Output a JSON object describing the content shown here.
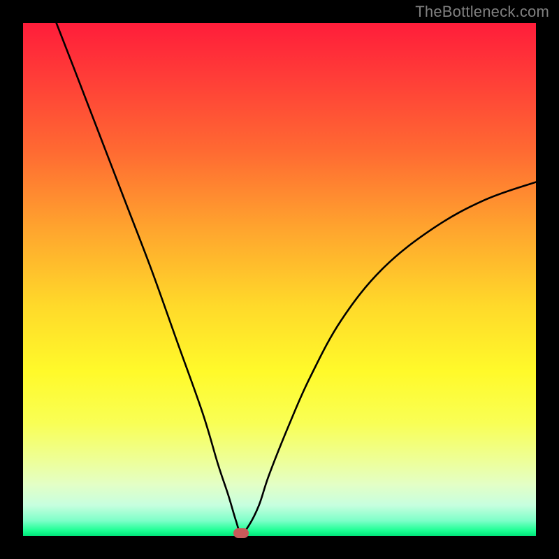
{
  "watermark": "TheBottleneck.com",
  "chart_data": {
    "type": "line",
    "title": "",
    "xlabel": "",
    "ylabel": "",
    "xlim": [
      0,
      100
    ],
    "ylim": [
      0,
      100
    ],
    "grid": false,
    "legend": false,
    "series": [
      {
        "name": "curve",
        "x": [
          6.5,
          10,
          15,
          20,
          25,
          30,
          35,
          38,
          40,
          41.5,
          42.5,
          44,
          46,
          48,
          52,
          56,
          62,
          70,
          80,
          90,
          100
        ],
        "y": [
          100,
          91,
          78,
          65,
          52,
          38,
          24,
          14,
          8,
          3,
          0.5,
          2,
          6,
          12,
          22,
          31,
          42,
          52,
          60,
          65.5,
          69
        ]
      }
    ],
    "marker": {
      "x": 42.5,
      "y": 0.5
    },
    "background_gradient": {
      "stops": [
        {
          "pos": 0,
          "color": "#ff1d3a"
        },
        {
          "pos": 10,
          "color": "#ff3b38"
        },
        {
          "pos": 25,
          "color": "#ff6a32"
        },
        {
          "pos": 40,
          "color": "#ffa42e"
        },
        {
          "pos": 55,
          "color": "#ffd92a"
        },
        {
          "pos": 68,
          "color": "#fffa2a"
        },
        {
          "pos": 78,
          "color": "#f9ff55"
        },
        {
          "pos": 85,
          "color": "#eeff95"
        },
        {
          "pos": 90,
          "color": "#e3ffc6"
        },
        {
          "pos": 94,
          "color": "#c7ffdf"
        },
        {
          "pos": 97,
          "color": "#7effc9"
        },
        {
          "pos": 99,
          "color": "#1aff92"
        },
        {
          "pos": 100,
          "color": "#00e57a"
        }
      ]
    }
  }
}
